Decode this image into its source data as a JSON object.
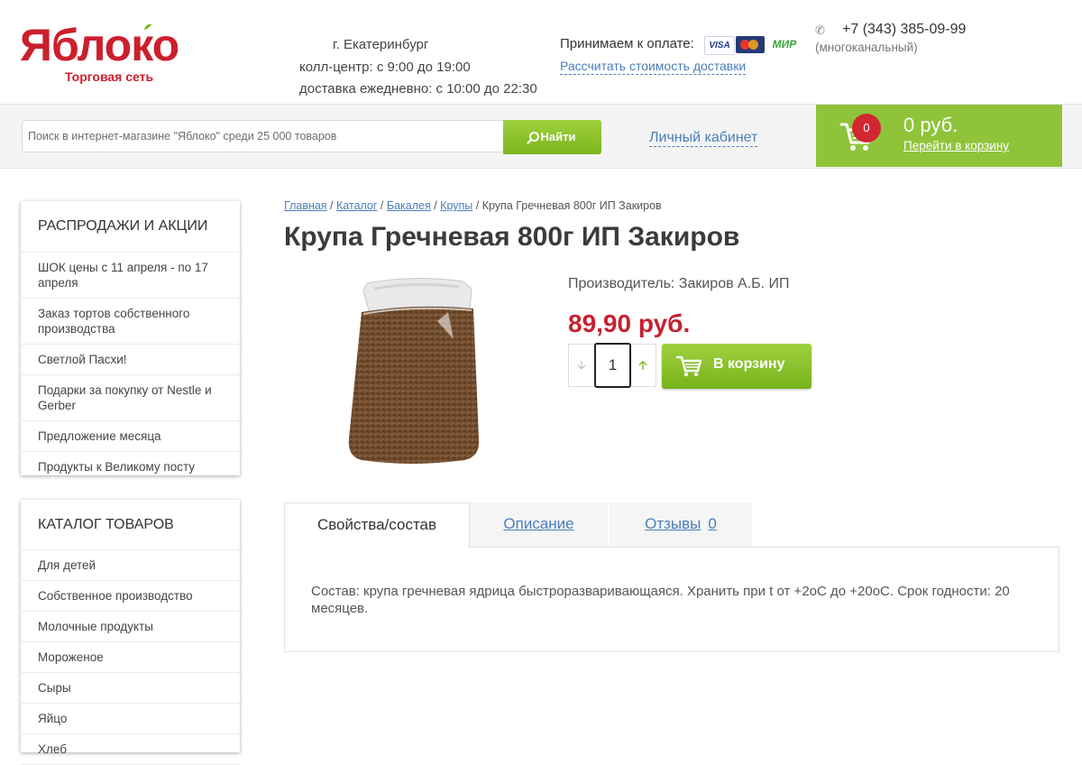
{
  "header": {
    "logo_text": "Яблоко",
    "logo_sub": "Торговая сеть",
    "city": "г. Екатеринбург",
    "call_center": "колл-центр: с 9:00 до 19:00",
    "delivery_hours": "доставка ежедневно: с 10:00 до 22:30",
    "payment_label": "Принимаем к оплате:",
    "cards": [
      "VISA",
      "MasterCard",
      "МИР"
    ],
    "delivery_link": "Рассчитать стоимость доставки",
    "phone": "+7 (343) 385-09-99",
    "phone_note": "(многоканальный)"
  },
  "search": {
    "placeholder": "Поиск в интернет-магазине \"Яблоко\" среди 25 000 товаров",
    "button": "Найти"
  },
  "account_link": "Личный кабинет",
  "cart": {
    "count": "0",
    "sum": "0 руб.",
    "link": "Перейти в корзину"
  },
  "sidebar": {
    "sales": {
      "title": "РАСПРОДАЖИ И АКЦИИ",
      "items": [
        "ШОК цены с 11 апреля - по 17 апреля",
        "Заказ тортов собственного производства",
        "Светлой Пасхи!",
        "Подарки за покупку от Nestle и Gerber",
        "Предложение месяца",
        "Продукты к Великому посту"
      ]
    },
    "catalog": {
      "title": "КАТАЛОГ ТОВАРОВ",
      "items": [
        "Для детей",
        "Собственное производство",
        "Молочные продукты",
        "Мороженое",
        "Сыры",
        "Яйцо",
        "Хлеб"
      ]
    }
  },
  "breadcrumbs": {
    "items": [
      "Главная",
      "Каталог",
      "Бакалея",
      "Крупы"
    ],
    "current": "Крупа Гречневая 800г ИП Закиров",
    "sep": " / "
  },
  "product": {
    "title": "Крупа Гречневая 800г ИП Закиров",
    "maker": "Производитель: Закиров А.Б. ИП",
    "price": "89,90 руб.",
    "qty": "1",
    "add_button": "В корзину"
  },
  "tabs": {
    "items": [
      "Свойства/состав",
      "Описание",
      "Отзывы"
    ],
    "reviews_count": "0",
    "content": "Состав: крупа гречневая ядрица быстроразваривающаяся. Хранить при t от +2оС до +20оС. Срок годности: 20 месяцев."
  },
  "colors": {
    "brand_red": "#cc1f2d",
    "green": "#8fc43a",
    "price_red": "#c6222f",
    "link_blue": "#4a7ebb"
  }
}
